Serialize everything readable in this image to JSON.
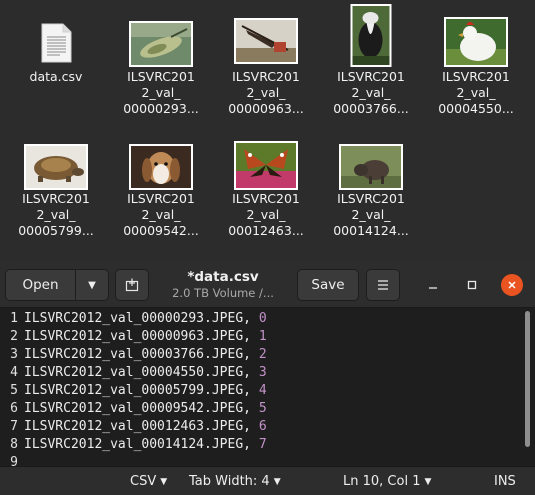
{
  "files": [
    {
      "name": "data.csv",
      "type": "csv-icon"
    },
    {
      "name": "ILSVRC2012_val_00000293...",
      "line1": "ILSVRC201",
      "line2": "2_val_",
      "line3": "00000293...",
      "thumb": "lizard-photo"
    },
    {
      "name": "ILSVRC2012_val_00000963...",
      "line1": "ILSVRC201",
      "line2": "2_val_",
      "line3": "00000963...",
      "thumb": "crane-photo"
    },
    {
      "name": "ILSVRC2012_val_00003766...",
      "line1": "ILSVRC201",
      "line2": "2_val_",
      "line3": "00003766...",
      "thumb": "skunk-photo"
    },
    {
      "name": "ILSVRC2012_val_00004550...",
      "line1": "ILSVRC201",
      "line2": "2_val_",
      "line3": "00004550...",
      "thumb": "rooster-photo"
    },
    {
      "name": "ILSVRC2012_val_00005799...",
      "line1": "ILSVRC201",
      "line2": "2_val_",
      "line3": "00005799...",
      "thumb": "tortoise-photo"
    },
    {
      "name": "ILSVRC2012_val_00009542...",
      "line1": "ILSVRC201",
      "line2": "2_val_",
      "line3": "00009542...",
      "thumb": "beagle-photo"
    },
    {
      "name": "ILSVRC2012_val_00012463...",
      "line1": "ILSVRC201",
      "line2": "2_val_",
      "line3": "00012463...",
      "thumb": "butterfly-photo"
    },
    {
      "name": "ILSVRC2012_val_00014124...",
      "line1": "ILSVRC201",
      "line2": "2_val_",
      "line3": "00014124...",
      "thumb": "boar-photo"
    }
  ],
  "header": {
    "open_label": "Open",
    "title": "*data.csv",
    "subtitle": "2.0 TB Volume /...",
    "save_label": "Save"
  },
  "editor": {
    "lines": [
      {
        "num": "1",
        "text": "ILSVRC2012_val_00000293.JPEG, ",
        "value": "0"
      },
      {
        "num": "2",
        "text": "ILSVRC2012_val_00000963.JPEG, ",
        "value": "1"
      },
      {
        "num": "3",
        "text": "ILSVRC2012_val_00003766.JPEG, ",
        "value": "2"
      },
      {
        "num": "4",
        "text": "ILSVRC2012_val_00004550.JPEG, ",
        "value": "3"
      },
      {
        "num": "5",
        "text": "ILSVRC2012_val_00005799.JPEG, ",
        "value": "4"
      },
      {
        "num": "6",
        "text": "ILSVRC2012_val_00009542.JPEG, ",
        "value": "5"
      },
      {
        "num": "7",
        "text": "ILSVRC2012_val_00012463.JPEG, ",
        "value": "6"
      },
      {
        "num": "8",
        "text": "ILSVRC2012_val_00014124.JPEG, ",
        "value": "7"
      },
      {
        "num": "9",
        "text": "",
        "value": ""
      }
    ]
  },
  "status": {
    "language": "CSV",
    "tab_width": "Tab Width: 4",
    "position": "Ln 10, Col 1",
    "mode": "INS"
  },
  "colors": {
    "accent": "#e95420",
    "number": "#c392c8",
    "background": "#2c2c2c"
  }
}
